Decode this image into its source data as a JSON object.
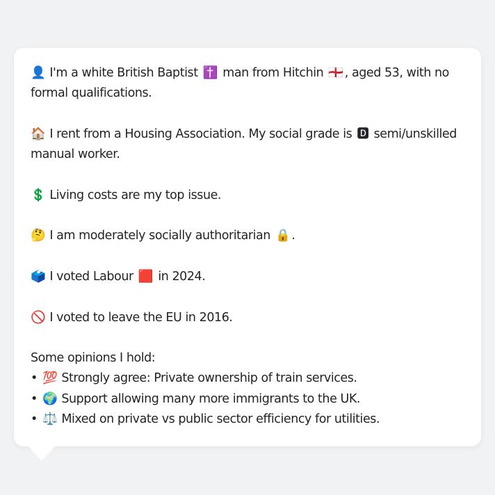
{
  "persona": {
    "identity": {
      "icon": "👤",
      "text_before_religion": "I'm a white British Baptist",
      "religion_icon": "✝️",
      "text_before_flag": "man from Hitchin",
      "flag_icon": "🏴󠁧󠁢󠁥󠁮󠁧󠁿",
      "text_after_flag_line1": ", aged 53, with no",
      "line2": "formal qualifications."
    },
    "housing": {
      "icon": "🏠",
      "text_before_grade": "I rent from a Housing Association. My social grade is",
      "grade_icon": "🅳",
      "text_after_grade_line1": "semi/unskilled",
      "line2": "manual worker."
    },
    "issue": {
      "icon": "💲",
      "text": "Living costs are my top issue."
    },
    "social": {
      "icon": "🤔",
      "text": "I am moderately socially authoritarian",
      "trailing_icon": "🔒",
      "trailing_text": "."
    },
    "vote2024": {
      "icon": "🗳️",
      "text_before_party": "I voted Labour",
      "party_icon": "🟥",
      "text_after_party": "in 2024."
    },
    "brexit": {
      "icon": "🚫",
      "text": "I voted to leave the EU in 2016."
    },
    "opinions": {
      "heading": "Some opinions I hold:",
      "bullet": "•",
      "items": [
        {
          "icon": "💯",
          "text": "Strongly agree: Private ownership of train services."
        },
        {
          "icon": "🌍",
          "text": "Support allowing many more immigrants to the UK."
        },
        {
          "icon": "⚖️",
          "text": "Mixed on private vs public sector efficiency for utilities."
        }
      ]
    }
  }
}
